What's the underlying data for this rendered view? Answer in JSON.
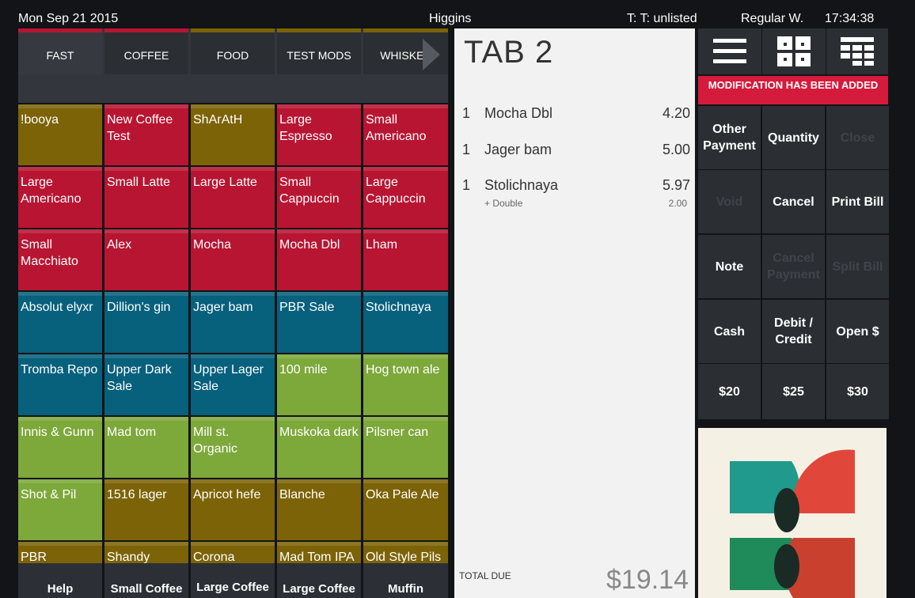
{
  "status": {
    "date": "Mon Sep 21 2015",
    "user": "Higgins",
    "table": "T: T: unlisted",
    "mode": "Regular W.",
    "time": "17:34:38"
  },
  "tabs": [
    {
      "label": "FAST",
      "active": true
    },
    {
      "label": "COFFEE",
      "active": false
    },
    {
      "label": "FOOD",
      "active": false
    },
    {
      "label": "TEST MODS",
      "active": false
    },
    {
      "label": "WHISKEY",
      "active": false
    }
  ],
  "colors": {
    "olive": "#7c6307",
    "crimson": "#b81532",
    "teal": "#07607c",
    "green": "#7da83a",
    "banner": "#d51b3c"
  },
  "grid": [
    [
      {
        "label": "!booya",
        "color": "olive"
      },
      {
        "label": "New Coffee Test",
        "color": "crimson"
      },
      {
        "label": "ShArAtH",
        "color": "olive"
      },
      {
        "label": "Large Espresso",
        "color": "crimson"
      },
      {
        "label": "Small Americano",
        "color": "crimson"
      }
    ],
    [
      {
        "label": "Large Americano",
        "color": "crimson"
      },
      {
        "label": "Small Latte",
        "color": "crimson"
      },
      {
        "label": "Large Latte",
        "color": "crimson"
      },
      {
        "label": "Small Cappuccin",
        "color": "crimson"
      },
      {
        "label": "Large Cappuccin",
        "color": "crimson"
      }
    ],
    [
      {
        "label": "Small Macchiato",
        "color": "crimson"
      },
      {
        "label": "Alex",
        "color": "crimson"
      },
      {
        "label": "Mocha",
        "color": "crimson"
      },
      {
        "label": "Mocha Dbl",
        "color": "crimson"
      },
      {
        "label": "Lham",
        "color": "crimson"
      }
    ],
    [
      {
        "label": "Absolut elyxr",
        "color": "teal"
      },
      {
        "label": "Dillion's gin",
        "color": "teal"
      },
      {
        "label": "Jager bam",
        "color": "teal"
      },
      {
        "label": "PBR Sale",
        "color": "teal"
      },
      {
        "label": "Stolichnaya",
        "color": "teal"
      }
    ],
    [
      {
        "label": "Tromba Repo",
        "color": "teal"
      },
      {
        "label": "Upper Dark Sale",
        "color": "teal"
      },
      {
        "label": "Upper Lager Sale",
        "color": "teal"
      },
      {
        "label": "100 mile",
        "color": "green"
      },
      {
        "label": "Hog town ale",
        "color": "green"
      }
    ],
    [
      {
        "label": "Innis & Gunn",
        "color": "green"
      },
      {
        "label": "Mad tom",
        "color": "green"
      },
      {
        "label": "Mill st. Organic",
        "color": "green"
      },
      {
        "label": "Muskoka dark",
        "color": "green"
      },
      {
        "label": "Pilsner can",
        "color": "green"
      }
    ],
    [
      {
        "label": "Shot & Pil",
        "color": "green"
      },
      {
        "label": "1516 lager",
        "color": "olive"
      },
      {
        "label": "Apricot hefe",
        "color": "olive"
      },
      {
        "label": "Blanche",
        "color": "olive"
      },
      {
        "label": "Oka Pale Ale",
        "color": "olive"
      }
    ],
    [
      {
        "label": "PBR",
        "color": "olive"
      },
      {
        "label": "Shandy",
        "color": "olive"
      },
      {
        "label": "Corona",
        "color": "olive"
      },
      {
        "label": "Mad Tom IPA",
        "color": "olive"
      },
      {
        "label": "Old Style Pils",
        "color": "olive"
      }
    ]
  ],
  "quick": [
    "Help",
    "Small Coffee",
    "Large Coffee",
    "Large Coffee",
    "Muffin"
  ],
  "receipt": {
    "title": "TAB 2",
    "lines": [
      {
        "qty": "1",
        "name": "Mocha Dbl",
        "price": "4.20"
      },
      {
        "qty": "1",
        "name": "Jager bam",
        "price": "5.00"
      },
      {
        "qty": "1",
        "name": "Stolichnaya",
        "price": "5.97",
        "mod": "+ Double",
        "mod_price": "2.00"
      }
    ],
    "total_label": "TOTAL DUE",
    "total": "$19.14"
  },
  "right_panel": {
    "icons": [
      "menu-lines-icon",
      "split-grid-icon",
      "table-layout-icon"
    ],
    "banner": "MODIFICATION HAS BEEN ADDED",
    "actions": [
      {
        "label": "Other Payment",
        "enabled": true
      },
      {
        "label": "Quantity",
        "enabled": true
      },
      {
        "label": "Close",
        "enabled": false
      },
      {
        "label": "Void",
        "enabled": false
      },
      {
        "label": "Cancel",
        "enabled": true
      },
      {
        "label": "Print Bill",
        "enabled": true
      },
      {
        "label": "Note",
        "enabled": true
      },
      {
        "label": "Cancel Payment",
        "enabled": false
      },
      {
        "label": "Split Bill",
        "enabled": false
      },
      {
        "label": "Cash",
        "enabled": true
      },
      {
        "label": "Debit / Credit",
        "enabled": true
      },
      {
        "label": "Open $",
        "enabled": true
      },
      {
        "label": "$20",
        "enabled": true
      },
      {
        "label": "$25",
        "enabled": true
      },
      {
        "label": "$30",
        "enabled": true
      }
    ]
  }
}
